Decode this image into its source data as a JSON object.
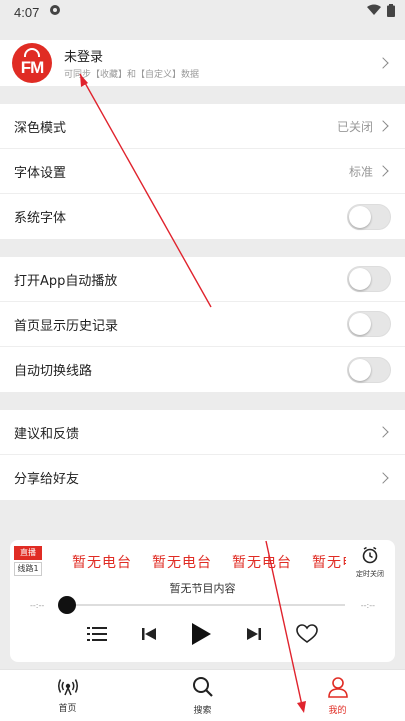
{
  "status_bar": {
    "time": "4:07"
  },
  "profile": {
    "logo_text": "FM",
    "name": "未登录",
    "hint": "可同步【收藏】和【自定义】数据"
  },
  "settings": {
    "dark_mode": {
      "label": "深色模式",
      "value": "已关闭"
    },
    "font_setting": {
      "label": "字体设置",
      "value": "标准"
    },
    "system_font": {
      "label": "系统字体",
      "enabled": false
    },
    "auto_play": {
      "label": "打开App自动播放",
      "enabled": false
    },
    "show_history": {
      "label": "首页显示历史记录",
      "enabled": false
    },
    "auto_switch_line": {
      "label": "自动切换线路",
      "enabled": false
    },
    "feedback": {
      "label": "建议和反馈"
    },
    "share": {
      "label": "分享给好友"
    }
  },
  "player": {
    "live_badge": "直播",
    "line_badge": "线路1",
    "station_marquee": [
      "暂无电台",
      "暂无电台",
      "暂无电台",
      "暂无电台"
    ],
    "timer_label": "定时关闭",
    "program": "暂无节目内容",
    "time_start": "--:--",
    "time_end": "--:--"
  },
  "tabbar": {
    "items": [
      {
        "label": "首页",
        "icon": "radio-icon",
        "active": false
      },
      {
        "label": "搜索",
        "icon": "search-icon",
        "active": false
      },
      {
        "label": "我的",
        "icon": "user-icon",
        "active": true
      }
    ]
  },
  "colors": {
    "accent": "#e02c24",
    "background": "#ececec",
    "annotation": "#e0232d"
  }
}
